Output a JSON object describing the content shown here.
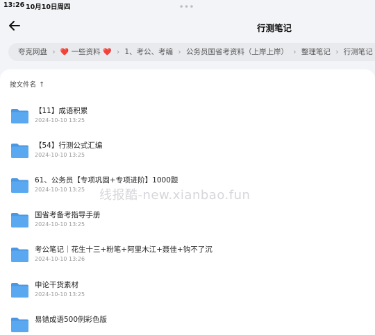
{
  "status": {
    "time": "13:26",
    "date": "10月10日周四",
    "dots": "•••"
  },
  "nav": {
    "back_icon": "arrow-left-icon",
    "title": "行测笔记"
  },
  "breadcrumb": {
    "items": [
      "夸克网盘",
      "一些资料",
      "1、考公、考编",
      "公务员国省考资料（上岸上岸）",
      "整理笔记",
      "行测笔记"
    ],
    "heart": "❤️"
  },
  "sort": {
    "label": "按文件名",
    "arrow": "↑"
  },
  "files": [
    {
      "name": "【11】成语积累",
      "time": "2024-10-10 13:25"
    },
    {
      "name": "【54】行测公式汇编",
      "time": "2024-10-10 13:25"
    },
    {
      "name": "61、公务员【专项巩固+专项进阶】1000题",
      "time": "2024-10-10 13:25"
    },
    {
      "name": "国省考备考指导手册",
      "time": "2024-10-10 13:25"
    },
    {
      "name": "考公笔记｜花生十三+粉笔+阿里木江+聂佳+钩不了沉",
      "time": "2024-10-10 13:26"
    },
    {
      "name": "申论干货素材",
      "time": "2024-10-10 13:25"
    },
    {
      "name": "易错成语500例彩色版",
      "time": ""
    }
  ],
  "watermark": "线报酷-new.xianbao.fun",
  "colors": {
    "folder": "#5aa9f0",
    "folder_back": "#4c97e3",
    "accent": "#111111"
  }
}
